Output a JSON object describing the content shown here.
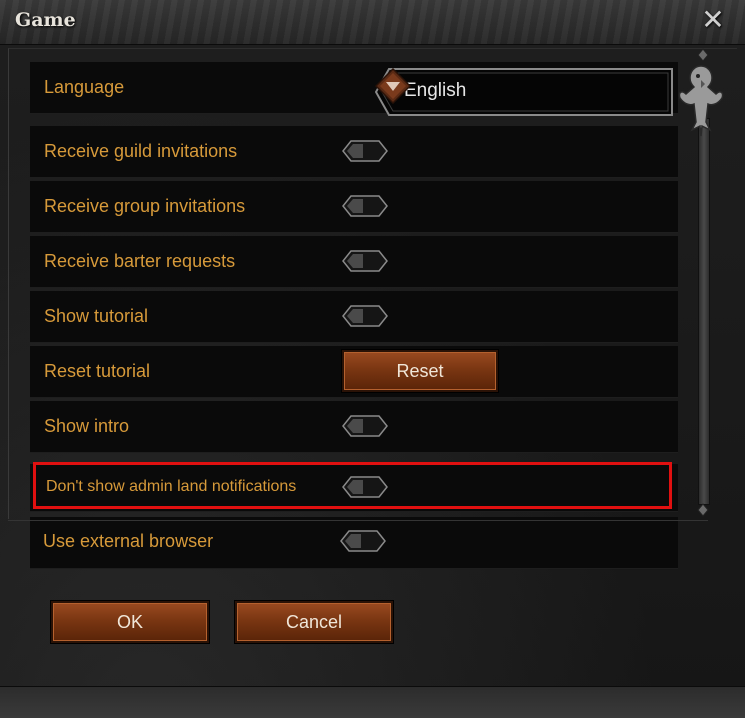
{
  "window": {
    "title": "Game",
    "close_icon": "close-x-icon"
  },
  "language": {
    "label": "Language",
    "value": "English",
    "arrow_icon": "dropdown-arrow-icon"
  },
  "settings": [
    {
      "label": "Receive guild invitations",
      "control": "toggle"
    },
    {
      "label": "Receive group invitations",
      "control": "toggle"
    },
    {
      "label": "Receive barter requests",
      "control": "toggle"
    },
    {
      "label": "Show tutorial",
      "control": "toggle"
    },
    {
      "label": "Reset tutorial",
      "control": "button",
      "button_label": "Reset"
    },
    {
      "label": "Show intro",
      "control": "toggle"
    },
    {
      "label": "Don't show admin land notifications",
      "control": "toggle",
      "highlighted": true
    },
    {
      "label": "Use external browser",
      "control": "toggle"
    }
  ],
  "footer": {
    "ok_label": "OK",
    "cancel_label": "Cancel"
  },
  "colors": {
    "label_text": "#d79a3a",
    "button_fill": "#7a3612",
    "highlight_border": "#e01010",
    "background": "#0a0a0a"
  },
  "decor": {
    "scroll_ornament_icon": "raven-ornament-icon"
  }
}
